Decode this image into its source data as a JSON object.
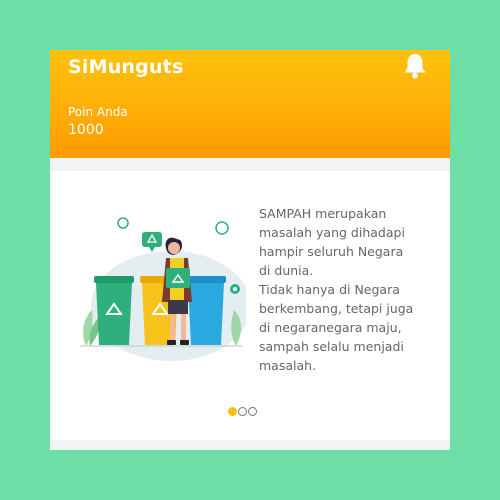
{
  "app": {
    "title": "SiMunguts"
  },
  "header": {
    "points_label": "Poin Anda",
    "points_value": "1000",
    "notification_icon": "bell-icon"
  },
  "carousel": {
    "slide_text": "SAMPAH merupakan\nmasalah yang dihadapi\nhampir seluruh Negara\ndi dunia.\nTidak hanya di Negara\nberkembang, tetapi juga\ndi negaranegara maju,\nsampah selalu menjadi\nmasalah.",
    "slide_count": 3,
    "active_index": 0,
    "illustration": "woman-recycling-trash-bins-illustration"
  },
  "colors": {
    "background": "#6ddfa6",
    "header_top": "#ffc20e",
    "header_bottom": "#ff9a00",
    "bin_green": "#2eaf7d",
    "bin_yellow": "#f7c21b",
    "bin_blue": "#2aa8e0",
    "dot_active": "#f5c010"
  }
}
